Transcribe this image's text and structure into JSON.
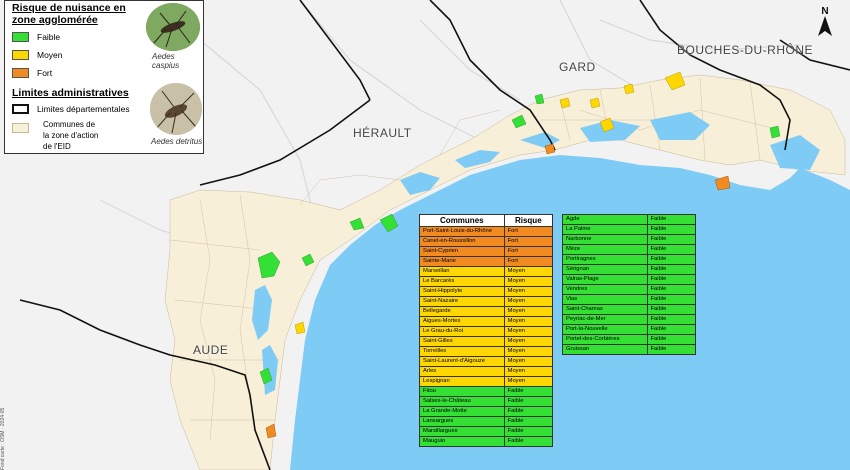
{
  "legend": {
    "nuisance_title": "Risque de nuisance en zone agglomérée",
    "levels": [
      {
        "label": "Faible",
        "color": "#33e033"
      },
      {
        "label": "Moyen",
        "color": "#ffd700"
      },
      {
        "label": "Fort",
        "color": "#f28a22"
      }
    ],
    "admin_title": "Limites administratives",
    "admin_items": [
      {
        "label": "Limites départementales"
      },
      {
        "label": "Communes de la zone d'action de l'EID"
      }
    ],
    "species": [
      "Aedes caspius",
      "Aedes detritus"
    ]
  },
  "departments": [
    "BOUCHES-DU-RHÔNE",
    "GARD",
    "HÉRAULT",
    "AUDE"
  ],
  "north_label": "N",
  "credit": "Fond carte : OSM · 2024-05",
  "colors": {
    "sea": "#7ecbf5",
    "zone": "#f7efd8",
    "land": "#f2f2f2",
    "green": "#33e033",
    "yellow": "#ffd700",
    "orange": "#f28a22"
  },
  "table1": {
    "headers": [
      "Communes",
      "Risque"
    ],
    "rows": [
      [
        "Port-Saint-Louis-du-Rhône",
        "Fort"
      ],
      [
        "Canet-en-Roussillon",
        "Fort"
      ],
      [
        "Saint-Cyprien",
        "Fort"
      ],
      [
        "Sainte-Marie",
        "Fort"
      ],
      [
        "Marseillan",
        "Moyen"
      ],
      [
        "Le Barcarès",
        "Moyen"
      ],
      [
        "Saint-Hippolyte",
        "Moyen"
      ],
      [
        "Saint-Nazaire",
        "Moyen"
      ],
      [
        "Bellegarde",
        "Moyen"
      ],
      [
        "Aigues-Mortes",
        "Moyen"
      ],
      [
        "Le Grau-du-Roi",
        "Moyen"
      ],
      [
        "Saint-Gilles",
        "Moyen"
      ],
      [
        "Torreilles",
        "Moyen"
      ],
      [
        "Saint-Laurent-d'Aigouze",
        "Moyen"
      ],
      [
        "Arles",
        "Moyen"
      ],
      [
        "Lespignan",
        "Moyen"
      ],
      [
        "Fitou",
        "Faible"
      ],
      [
        "Salses-le-Château",
        "Faible"
      ],
      [
        "La Grande-Motte",
        "Faible"
      ],
      [
        "Lansargues",
        "Faible"
      ],
      [
        "Marsillargues",
        "Faible"
      ],
      [
        "Mauguio",
        "Faible"
      ]
    ]
  },
  "table2": {
    "rows": [
      [
        "Agde",
        "Faible"
      ],
      [
        "La Palme",
        "Faible"
      ],
      [
        "Narbonne",
        "Faible"
      ],
      [
        "Mèze",
        "Faible"
      ],
      [
        "Portiragnes",
        "Faible"
      ],
      [
        "Sérignan",
        "Faible"
      ],
      [
        "Valras-Plage",
        "Faible"
      ],
      [
        "Vendres",
        "Faible"
      ],
      [
        "Vias",
        "Faible"
      ],
      [
        "Saint-Chamas",
        "Faible"
      ],
      [
        "Peyriac-de-Mer",
        "Faible"
      ],
      [
        "Port-la-Nouvelle",
        "Faible"
      ],
      [
        "Portel-des-Corbières",
        "Faible"
      ],
      [
        "Gruissan",
        "Faible"
      ]
    ]
  }
}
